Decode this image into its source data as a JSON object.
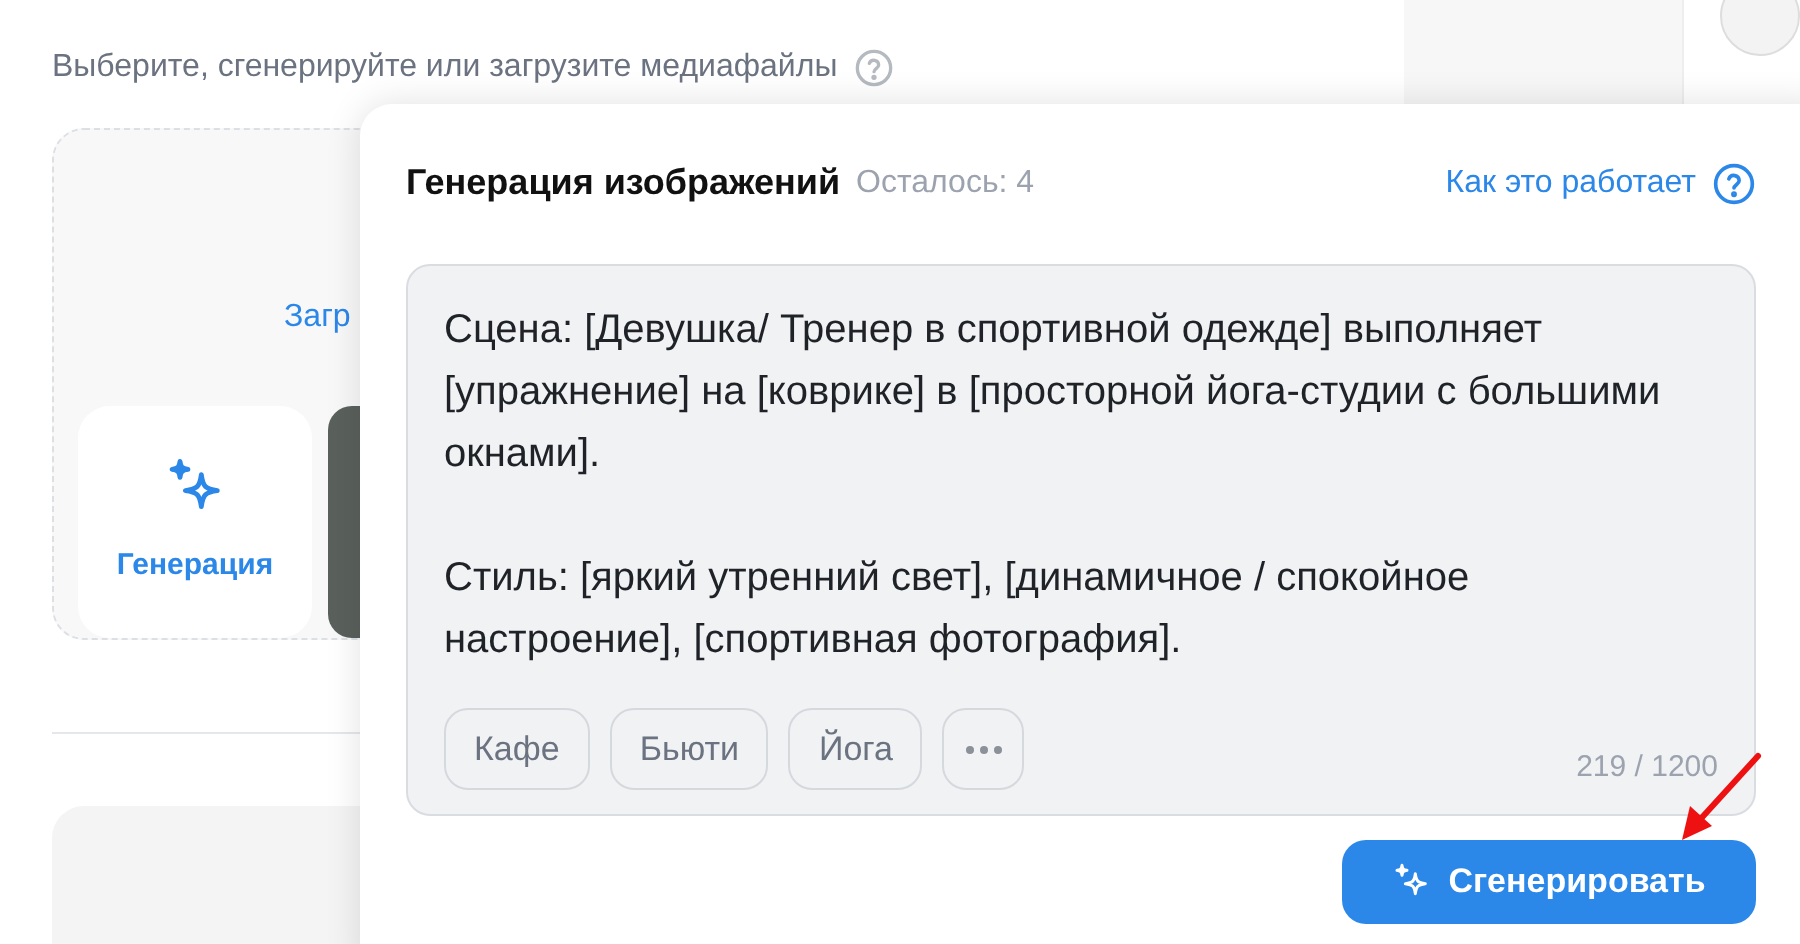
{
  "page": {
    "subtitle": "Выберите, сгенерируйте или загрузите медиафайлы",
    "upload_label": "Загр",
    "generate_tile": "Генерация"
  },
  "popup": {
    "title": "Генерация изображений",
    "remaining": "Осталось: 4",
    "help_link": "Как это работает",
    "prompt": {
      "value": "Сцена: [Девушка/ Тренер в спортивной одежде] выполняет [упражнение] на [коврике] в [просторной йога-студии с большими окнами].\n\nСтиль: [яркий утренний свет], [динамичное / спокойное настроение], [спортивная фотография]."
    },
    "tags": [
      "Кафе",
      "Бьюти",
      "Йога"
    ],
    "counter": "219 / 1200",
    "generate_button": "Сгенерировать"
  }
}
